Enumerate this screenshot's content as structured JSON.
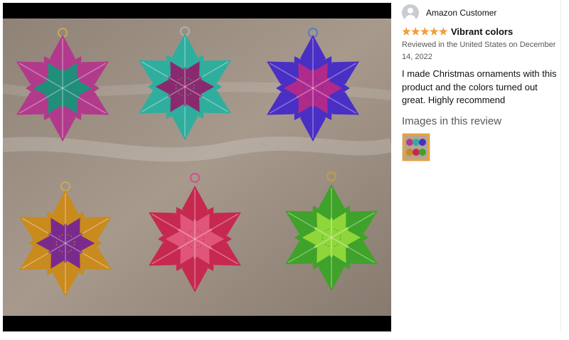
{
  "review": {
    "profile_name": "Amazon Customer",
    "rating": 5,
    "rating_max": 5,
    "title": "Vibrant colors",
    "meta": "Reviewed in the United States on December 14, 2022",
    "body": "I made Christmas ornaments with this product and the colors turned out great. Highly recommend",
    "images_heading": "Images in this review"
  },
  "icons": {
    "avatar": "user-avatar-icon",
    "star": "star-icon"
  },
  "colors": {
    "star": "#ff9f1c",
    "meta_text": "#565959",
    "body_text": "#0f1111",
    "photo_background": "#9a8e82"
  }
}
